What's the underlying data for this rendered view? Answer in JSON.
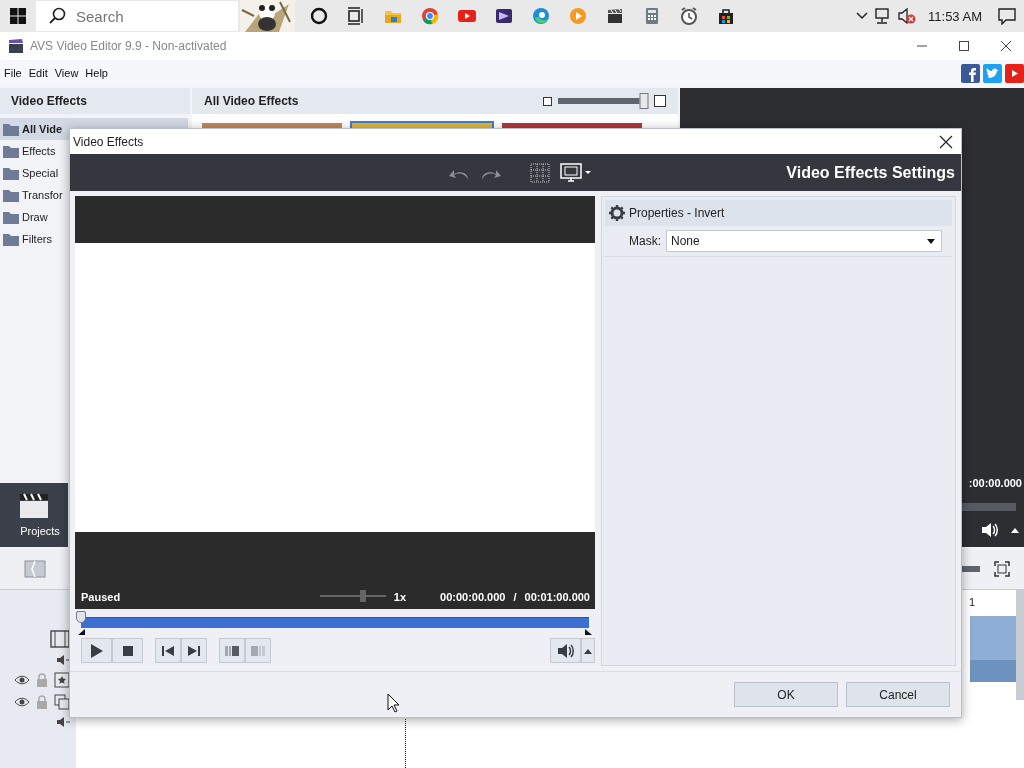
{
  "taskbar": {
    "search": {
      "placeholder": "Search"
    },
    "clock": "11:53 AM"
  },
  "window": {
    "title": "AVS Video Editor 9.9 - Non-activated"
  },
  "menu": [
    "File",
    "Edit",
    "View",
    "Help"
  ],
  "sidebar": {
    "title": "Video Effects",
    "items": [
      {
        "label": "All Vide",
        "selected": true
      },
      {
        "label": "Effects",
        "selected": false
      },
      {
        "label": "Special",
        "selected": false
      },
      {
        "label": "Transfor",
        "selected": false
      },
      {
        "label": "Draw",
        "selected": false
      },
      {
        "label": "Filters",
        "selected": false
      }
    ]
  },
  "gallery": {
    "title": "All Video Effects",
    "zoom": {
      "level": 0.95
    },
    "thumbnails": [
      {
        "kind": "picture",
        "selected": false
      },
      {
        "kind": "picture",
        "selected": true
      },
      {
        "kind": "picture",
        "selected": false
      }
    ]
  },
  "preview": {
    "time": ":00:00.000",
    "progress": {
      "level": 0
    }
  },
  "projects": {
    "label": "Projects"
  },
  "timeline": {
    "ruler": "1"
  },
  "dialog": {
    "title": "Video Effects",
    "heading": "Video Effects Settings",
    "player": {
      "status": "Paused",
      "speed": {
        "label": "1x",
        "level": 0.66
      },
      "current_time": "00:00:00.000",
      "separator": "/",
      "duration": "00:01:00.000",
      "seek": {
        "level": 0
      }
    },
    "properties": {
      "title": "Properties - Invert",
      "fields": [
        {
          "label": "Mask:",
          "value": "None"
        }
      ]
    },
    "buttons": [
      "OK",
      "Cancel"
    ]
  }
}
